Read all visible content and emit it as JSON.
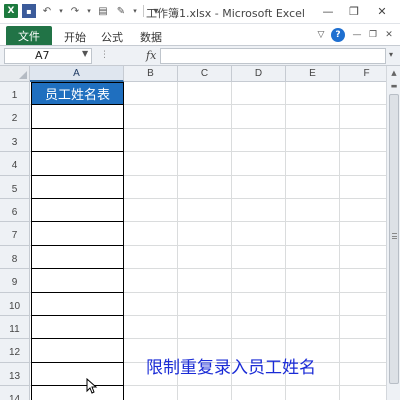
{
  "window": {
    "title": "工作簿1.xlsx - Microsoft Excel",
    "controls": {
      "minimize": "—",
      "restore": "❐",
      "close": "✕"
    }
  },
  "qat": {
    "app_icon": "X",
    "undo": "↶",
    "redo": "↷",
    "dropdown": "▾"
  },
  "ribbon": {
    "file_tab": "文件",
    "tabs": [
      "开始",
      "公式",
      "数据"
    ],
    "help": "?",
    "minimize_ribbon": "▽"
  },
  "formula_bar": {
    "name_box": "A7",
    "fx_label": "fx",
    "formula": ""
  },
  "sheet": {
    "columns": [
      "A",
      "B",
      "C",
      "D",
      "E",
      "F"
    ],
    "selected_column": "A",
    "rows": [
      "1",
      "2",
      "3",
      "4",
      "5",
      "6",
      "7",
      "8",
      "9",
      "10",
      "11",
      "12",
      "13",
      "14"
    ],
    "cells": {
      "A1": "员工姓名表"
    },
    "header_fill": "#1f6fbf"
  },
  "overlay": {
    "caption": "限制重复录入员工姓名",
    "caption_color": "#1a2bd6"
  }
}
